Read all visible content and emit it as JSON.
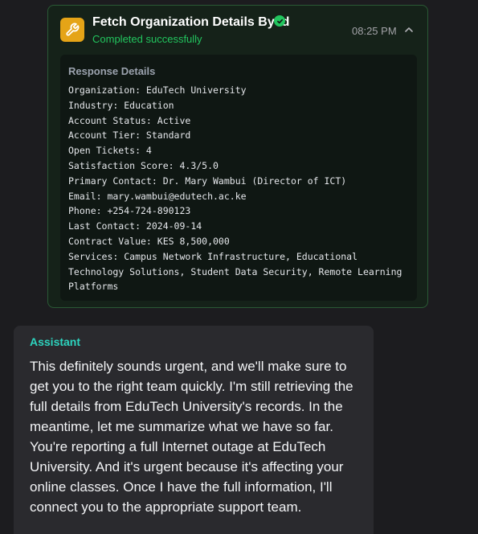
{
  "tool_call": {
    "title": "Fetch Organization Details By Id",
    "status": "Completed successfully",
    "time": "08:25 PM",
    "icon": "wrench-icon",
    "response": {
      "heading": "Response Details",
      "lines": [
        "Organization: EduTech University",
        "Industry: Education",
        "Account Status: Active",
        "Account Tier: Standard",
        "Open Tickets: 4",
        "Satisfaction Score: 4.3/5.0",
        "Primary Contact: Dr. Mary Wambui (Director of ICT)",
        "Email: mary.wambui@edutech.ac.ke",
        "Phone: +254-724-890123",
        "Last Contact: 2024-09-14",
        "Contract Value: KES 8,500,000",
        "Services: Campus Network Infrastructure, Educational",
        "Technology Solutions, Student Data Security, Remote Learning",
        "Platforms"
      ]
    }
  },
  "assistant": {
    "label": "Assistant",
    "message": "This definitely sounds urgent, and we'll make sure to get you to the right team quickly. I'm still retrieving the full details from EduTech University's records. In the meantime, let me summarize what we have so far. You're reporting a full Internet outage at EduTech University. And it's urgent because it's affecting your online classes. Once I have the full information, I'll connect you to the appropriate support team."
  },
  "colors": {
    "background": "#1c1c1f",
    "tool_card_bg": "#152219",
    "tool_card_border": "#2a5a35",
    "success": "#22c55e",
    "icon_bg": "#e5a417",
    "assistant_label": "#2dd4bf",
    "assistant_bg": "#2a2a2e"
  }
}
